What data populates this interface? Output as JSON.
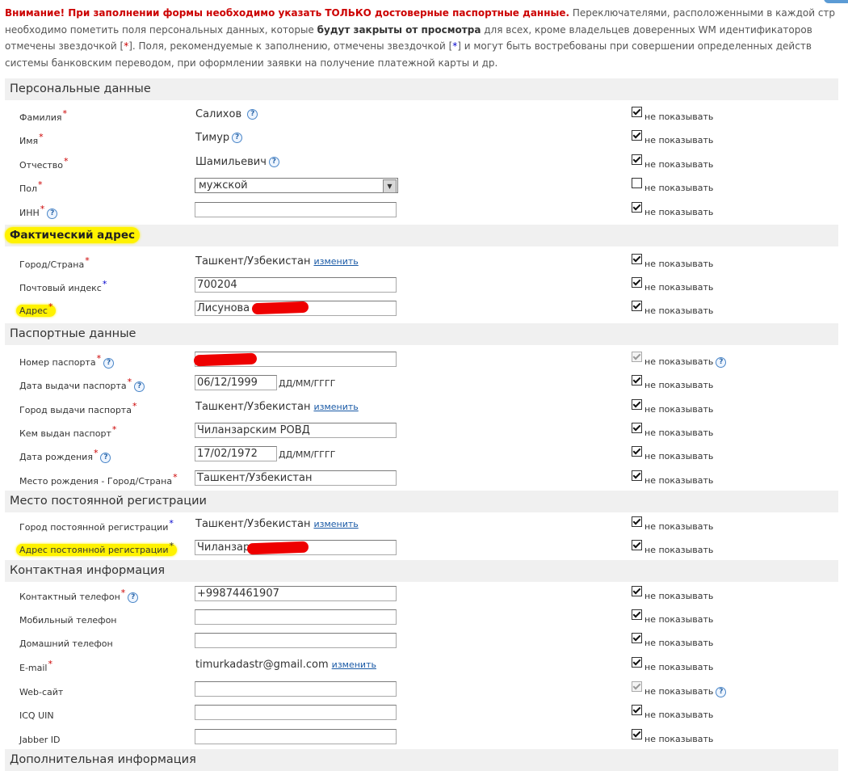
{
  "notice": {
    "warning": "Внимание! При заполнении формы необходимо указать ТОЛЬКО достоверные паспортные данные.",
    "line1_rest": " Переключателями, расположенными в каждой стр",
    "line2_a": "необходимо пометить поля персональных данных, которые ",
    "line2_bold": "будут закрыты от просмотра",
    "line2_b": " для всех, кроме владельцев доверенных WM идентификаторов",
    "line3_a": "отмечены звездочкой [",
    "star": "*",
    "line3_b": "]. Поля, рекомендуемые к заполнению, отмечены звездочкой [",
    "line3_c": "] и могут быть востребованы при совершении определенных действ",
    "line4": "системы банковским переводом, при оформлении заявки на получение платежной карты и др."
  },
  "hide_label": "не показывать",
  "change_link": "изменить",
  "date_format": "ДД/ММ/ГГГГ",
  "sections": {
    "personal": "Персональные данные",
    "actual_address": "Фактический адрес",
    "passport": "Паспортные данные",
    "registration": "Место постоянной регистрации",
    "contacts": "Контактная информация",
    "additional": "Дополнительная информация"
  },
  "fields": {
    "surname": {
      "label": "Фамилия",
      "value": "Салихов"
    },
    "name": {
      "label": "Имя",
      "value": "Тимур"
    },
    "patronymic": {
      "label": "Отчество",
      "value": "Шамильевич"
    },
    "gender": {
      "label": "Пол",
      "value": "мужской"
    },
    "inn": {
      "label": "ИНН",
      "value": ""
    },
    "city_country": {
      "label": "Город/Страна",
      "value": "Ташкент/Узбекистан"
    },
    "postal_code": {
      "label": "Почтовый индекс",
      "value": "700204"
    },
    "address": {
      "label": "Адрес",
      "value": "Лисунова"
    },
    "passport_number": {
      "label": "Номер паспорта",
      "value": ""
    },
    "issue_date": {
      "label": "Дата выдачи паспорта",
      "value": "06/12/1999"
    },
    "issue_city": {
      "label": "Город выдачи паспорта",
      "value": "Ташкент/Узбекистан"
    },
    "issued_by": {
      "label": "Кем выдан паспорт",
      "value": "Чилaнзарским РОВД"
    },
    "birth_date": {
      "label": "Дата рождения",
      "value": "17/02/1972"
    },
    "birth_place": {
      "label": "Место рождения - Город/Страна",
      "value": "Ташкент/Узбекистан"
    },
    "reg_city": {
      "label": "Город постоянной регистрации",
      "value": "Ташкент/Узбекистан"
    },
    "reg_address": {
      "label": "Адрес постоянной регистрации",
      "value": "Чиланзар"
    },
    "contact_phone": {
      "label": "Контактный телефон",
      "value": "+99874461907"
    },
    "mobile_phone": {
      "label": "Мобильный телефон",
      "value": ""
    },
    "home_phone": {
      "label": "Домашний телефон",
      "value": ""
    },
    "email": {
      "label": "E-mail",
      "value": "timurkadastr@gmail.com"
    },
    "website": {
      "label": "Web-сайт",
      "value": ""
    },
    "icq": {
      "label": "ICQ UIN",
      "value": ""
    },
    "jabber": {
      "label": "Jabber ID",
      "value": ""
    }
  },
  "colors": {
    "highlight": "#fff200",
    "required": "#cc0000",
    "recommended": "#0000cc",
    "link": "#1a5aa6"
  }
}
